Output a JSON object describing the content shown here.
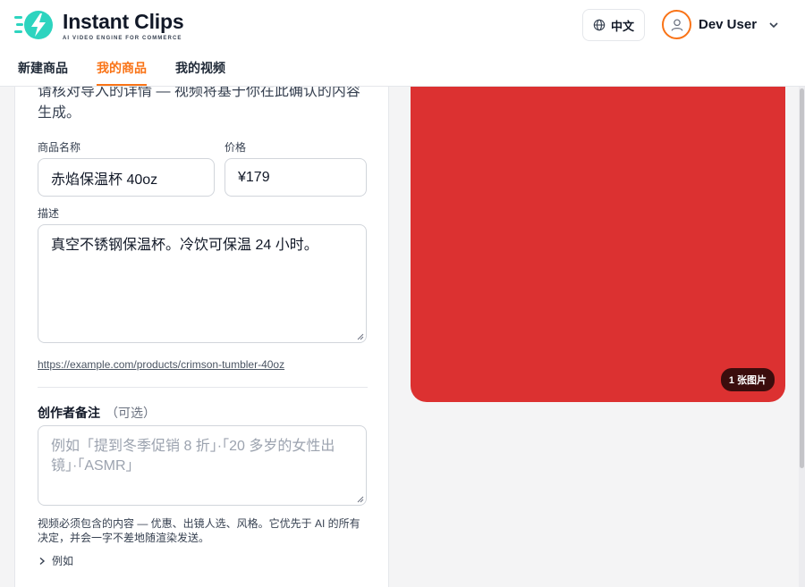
{
  "header": {
    "brand_title": "Instant Clips",
    "brand_tagline": "AI VIDEO ENGINE FOR COMMERCE",
    "language_label": "中文",
    "user_name": "Dev User",
    "accent_color": "#f97316"
  },
  "tabs": [
    {
      "label": "新建商品",
      "active": false
    },
    {
      "label": "我的商品",
      "active": true
    },
    {
      "label": "我的视频",
      "active": false
    }
  ],
  "form": {
    "intro": "请核对导入的详情 — 视频将基于你在此确认的内容生成。",
    "name_label": "商品名称",
    "name_value": "赤焰保温杯 40oz",
    "price_label": "价格",
    "price_value": "¥179",
    "desc_label": "描述",
    "desc_value": "真空不锈钢保温杯。冷饮可保温 24 小时。",
    "source_url": "https://example.com/products/crimson-tumbler-40oz",
    "notes_label": "创作者备注",
    "notes_optional": "（可选）",
    "notes_placeholder": "例如「提到冬季促销 8 折」·「20 多岁的女性出镜」·「ASMR」",
    "help_text": "视频必须包含的内容 — 优惠、出镜人选、风格。它优先于 AI 的所有决定，并会一字不差地随渲染发送。",
    "examples_toggle": "例如"
  },
  "preview": {
    "image_color": "#dc3131",
    "image_count_badge": "1 张图片"
  }
}
